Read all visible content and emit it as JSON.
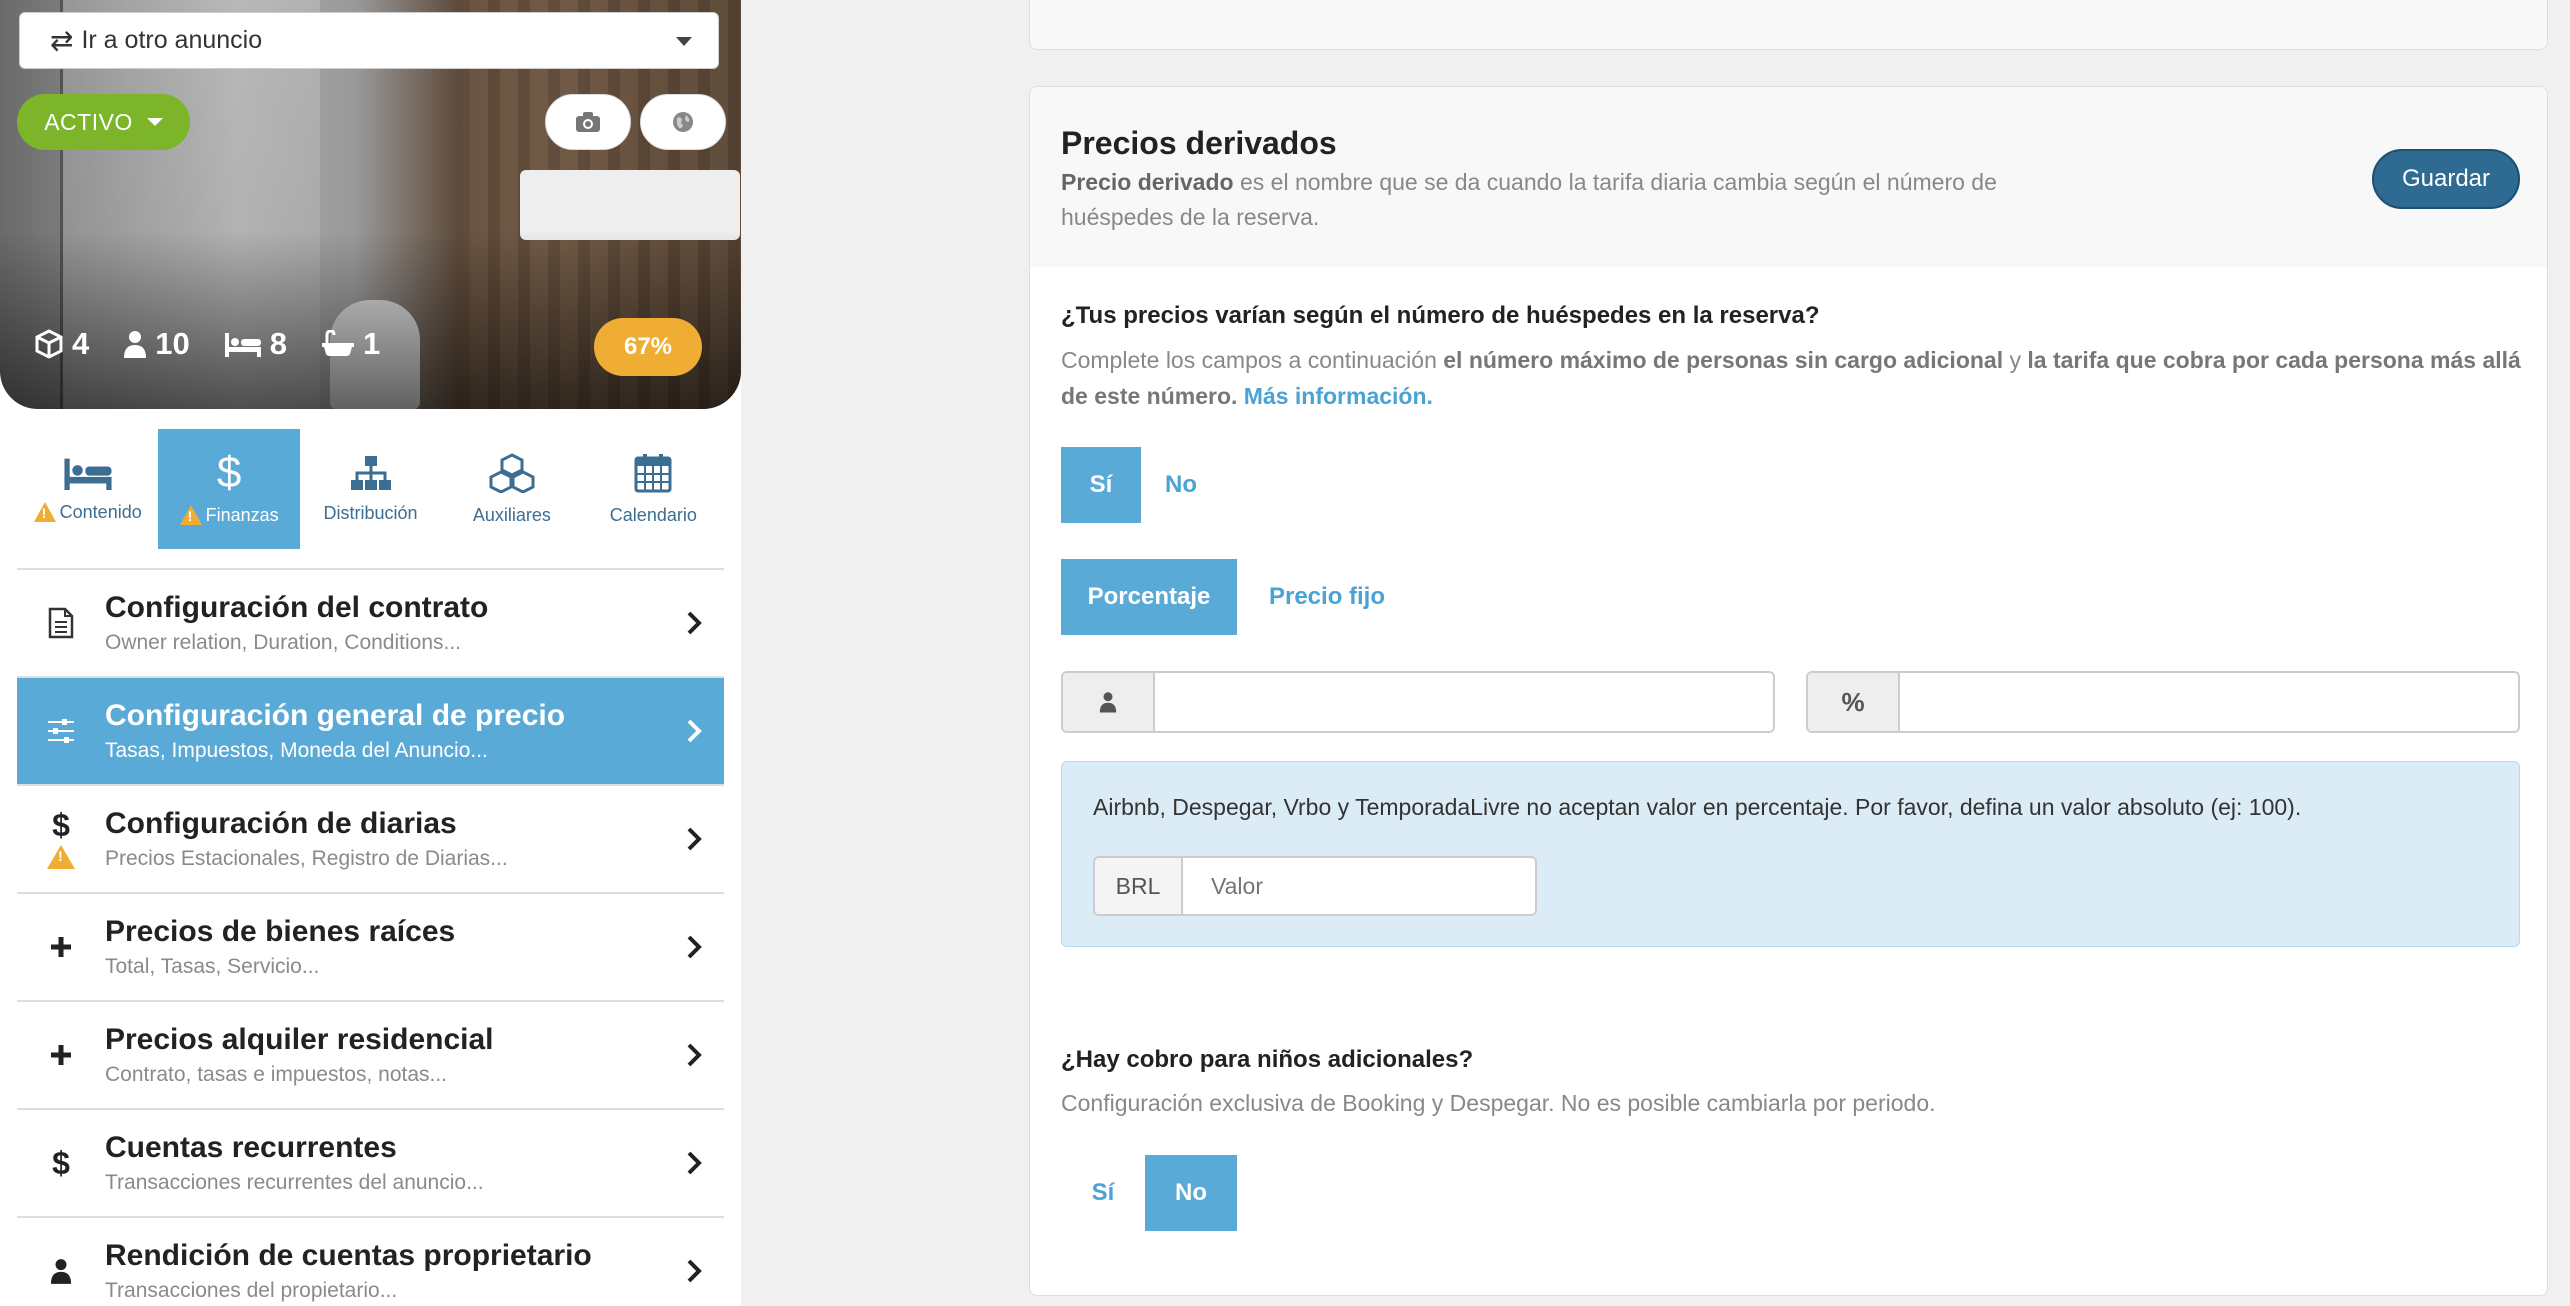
{
  "listing": {
    "select_label": "Ir a otro anuncio",
    "status_label": "ACTIVO",
    "stats": [
      {
        "icon": "cube-icon",
        "value": "4"
      },
      {
        "icon": "person-icon",
        "value": "10"
      },
      {
        "icon": "bed-icon",
        "value": "8"
      },
      {
        "icon": "bathtub-icon",
        "value": "1"
      }
    ],
    "score": "67%"
  },
  "tabs": [
    {
      "label": "Contenido",
      "icon": "bed-icon",
      "warning": true
    },
    {
      "label": "Finanzas",
      "icon": "dollar-icon",
      "warning": true,
      "active": true
    },
    {
      "label": "Distribución",
      "icon": "sitemap-icon",
      "warning": false
    },
    {
      "label": "Auxiliares",
      "icon": "cubes-icon",
      "warning": false
    },
    {
      "label": "Calendario",
      "icon": "calendar-icon",
      "warning": false
    }
  ],
  "menu": [
    {
      "title": "Configuración del contrato",
      "subtitle": "Owner relation, Duration, Conditions...",
      "icon": "document-icon"
    },
    {
      "title": "Configuración general de precio",
      "subtitle": "Tasas, Impuestos, Moneda del Anuncio...",
      "icon": "sliders-icon",
      "active": true
    },
    {
      "title": "Configuración de diarias",
      "subtitle": "Precios Estacionales, Registro de Diarias...",
      "icon": "dollar-icon",
      "warning": true
    },
    {
      "title": "Precios de bienes raíces",
      "subtitle": "Total, Tasas, Servicio...",
      "icon": "plus-icon"
    },
    {
      "title": "Precios alquiler residencial",
      "subtitle": "Contrato, tasas e impuestos, notas...",
      "icon": "plus-icon"
    },
    {
      "title": "Cuentas recurrentes",
      "subtitle": "Transacciones recurrentes del anuncio...",
      "icon": "dollar-icon"
    },
    {
      "title": "Rendición de cuentas proprietario",
      "subtitle": "Transacciones del propietario...",
      "icon": "user-icon"
    }
  ],
  "card": {
    "title": "Precios derivados",
    "desc_bold": "Precio derivado",
    "desc_rest": " es el nombre que se da cuando la tarifa diaria cambia según el número de huéspedes de la reserva.",
    "save_label": "Guardar"
  },
  "q1": {
    "title": "¿Tus precios varían según el número de huéspedes en la reserva?",
    "desc_a": "Complete los campos a continuación ",
    "desc_b": "el número máximo de personas sin cargo adicional",
    "desc_c": " y ",
    "desc_d": "la tarifa que cobra por cada persona más allá de este número.",
    "desc_link": "Más información.",
    "yes": "Sí",
    "no": "No",
    "type_pct": "Porcentaje",
    "type_fixed": "Precio fijo",
    "pct_symbol": "%",
    "guests_value": "",
    "pct_value": ""
  },
  "alert": {
    "text": "Airbnb, Despegar, Vrbo y TemporadaLivre no aceptan valor en percentaje. Por favor, defina un valor absoluto (ej: 100).",
    "currency": "BRL",
    "placeholder": "Valor"
  },
  "q2": {
    "title": "¿Hay cobro para niños adicionales?",
    "desc": "Configuración exclusiva de Booking y Despegar. No es posible cambiarla por periodo.",
    "yes": "Sí",
    "no": "No"
  }
}
